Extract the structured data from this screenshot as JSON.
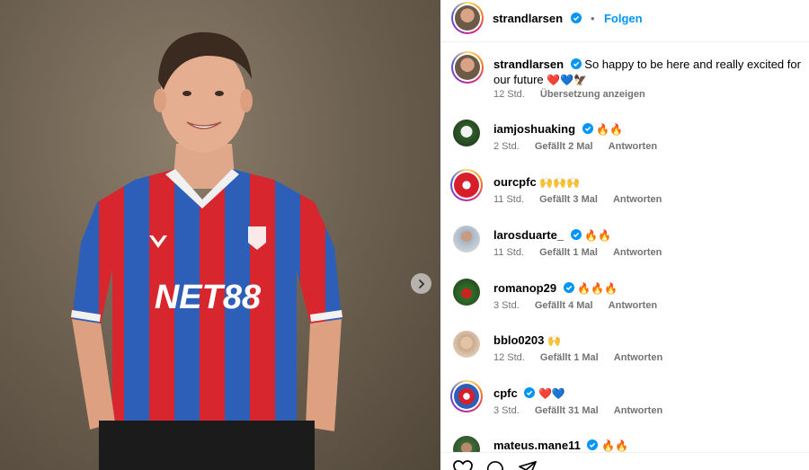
{
  "post": {
    "author": "strandlarsen",
    "follow_label": "Folgen",
    "separator": "•"
  },
  "caption": {
    "username": "strandlarsen",
    "text": "So happy to be here and really excited for our future",
    "emoji": "❤️💙🦅",
    "time": "12 Std.",
    "translate_label": "Übersetzung anzeigen"
  },
  "comments": [
    {
      "username": "iamjoshuaking",
      "verified": true,
      "text": "🔥🔥",
      "time": "2 Std.",
      "likes": "Gefällt 2 Mal",
      "reply": "Antworten"
    },
    {
      "username": "ourcpfc",
      "verified": false,
      "text": "🙌🙌🙌",
      "time": "11 Std.",
      "likes": "Gefällt 3 Mal",
      "reply": "Antworten"
    },
    {
      "username": "larosduarte_",
      "verified": true,
      "text": "🔥🔥",
      "time": "11 Std.",
      "likes": "Gefällt 1 Mal",
      "reply": "Antworten"
    },
    {
      "username": "romanop29",
      "verified": true,
      "text": "🔥🔥🔥",
      "time": "3 Std.",
      "likes": "Gefällt 4 Mal",
      "reply": "Antworten"
    },
    {
      "username": "bblo0203",
      "verified": false,
      "text": "🙌",
      "time": "12 Std.",
      "likes": "Gefällt 1 Mal",
      "reply": "Antworten"
    },
    {
      "username": "cpfc",
      "verified": true,
      "text": "❤️💙",
      "time": "3 Std.",
      "likes": "Gefällt 31 Mal",
      "reply": "Antworten"
    },
    {
      "username": "mateus.mane11",
      "verified": true,
      "text": "🔥🔥",
      "time": "",
      "likes": "",
      "reply": ""
    }
  ],
  "shirt": {
    "sponsor": "NET88"
  },
  "colors": {
    "accent": "#0095f6",
    "verified": "#0095f6",
    "meta_text": "#737373",
    "kit_red": "#d8262f",
    "kit_blue": "#2d5fb8"
  },
  "icons": {
    "next": "chevron-right-icon",
    "like": "heart-icon",
    "comment": "comment-icon",
    "share": "send-icon",
    "verified": "verified-badge-icon"
  }
}
